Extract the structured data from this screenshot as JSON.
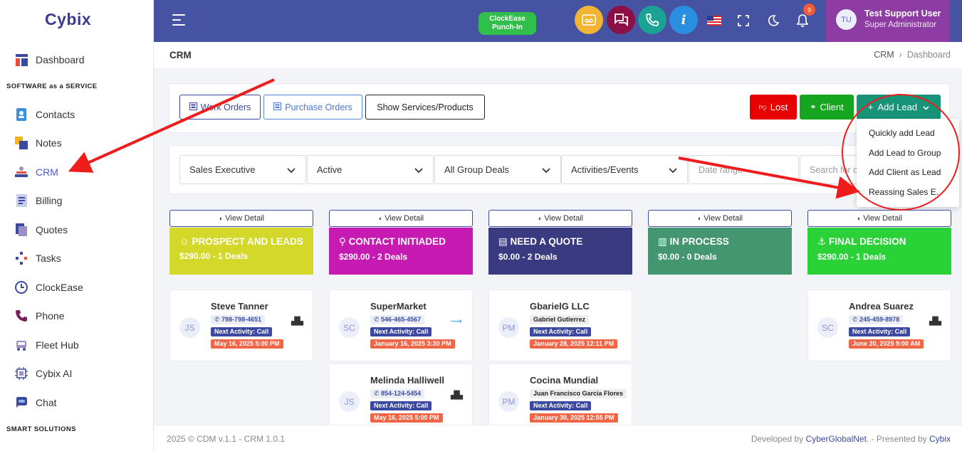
{
  "sidebar": {
    "logo": "Cybix",
    "sections": [
      "SOFTWARE as a SERVICE",
      "SMART SOLUTIONS"
    ],
    "items": [
      {
        "label": "Dashboard",
        "icon": "dashboard-icon"
      },
      {
        "label": "Contacts",
        "icon": "contacts-icon"
      },
      {
        "label": "Notes",
        "icon": "notes-icon"
      },
      {
        "label": "CRM",
        "icon": "crm-icon",
        "active": true
      },
      {
        "label": "Billing",
        "icon": "billing-icon"
      },
      {
        "label": "Quotes",
        "icon": "quotes-icon"
      },
      {
        "label": "Tasks",
        "icon": "tasks-icon"
      },
      {
        "label": "ClockEase",
        "icon": "clock-icon"
      },
      {
        "label": "Phone",
        "icon": "phone-icon"
      },
      {
        "label": "Fleet Hub",
        "icon": "truck-icon"
      },
      {
        "label": "Cybix AI",
        "icon": "ai-chip-icon"
      },
      {
        "label": "Chat",
        "icon": "chat-icon"
      }
    ]
  },
  "header": {
    "punch_label": "ClockEase Punch-In",
    "info_icon": "i",
    "notification_count": "9",
    "user": {
      "initials": "TU",
      "name": "Test Support User",
      "role": "Super Administrator"
    }
  },
  "page": {
    "title": "CRM",
    "breadcrumb": [
      "CRM",
      "Dashboard"
    ]
  },
  "toolbar": {
    "work_orders": "Work Orders",
    "purchase_orders": "Purchase Orders",
    "show_services": "Show Services/Products",
    "lost": "Lost",
    "client": "Client",
    "add_lead": "Add Lead"
  },
  "add_lead_menu": [
    "Quickly add Lead",
    "Add Lead to Group",
    "Add Client as Lead",
    "Reassing Sales E."
  ],
  "filters": {
    "sales_executive": "Sales Executive",
    "status": "Active",
    "group": "All Group Deals",
    "activities": "Activities/Events",
    "date_placeholder": "Date range",
    "search_placeholder": "Search for c"
  },
  "view_detail": "View Detail",
  "stages": [
    {
      "title": "PROSPECT AND LEADS",
      "summary": "$290.00 - 1 Deals",
      "color": "#d4d82a"
    },
    {
      "title": "CONTACT INITIADED",
      "summary": "$290.00 - 2 Deals",
      "color": "#c71ab2"
    },
    {
      "title": "NEED A QUOTE",
      "summary": "$0.00 - 2 Deals",
      "color": "#3a3a80"
    },
    {
      "title": "IN PROCESS",
      "summary": "$0.00 - 0 Deals",
      "color": "#449670"
    },
    {
      "title": "FINAL DECISION",
      "summary": "$290.00 - 1 Deals",
      "color": "#2ad238"
    }
  ],
  "deals": [
    {
      "initials": "JS",
      "name": "Steve Tanner",
      "phone": "798-798-4651",
      "next": "Next Activity: Call",
      "date": "May 16, 2025 5:00 PM"
    },
    {
      "initials": "SC",
      "name": "SuperMarket",
      "phone": "546-465-4567",
      "next": "Next Activity: Call",
      "date": "January 16, 2025 3:30 PM"
    },
    {
      "initials": "JS",
      "name": "Melinda Halliwell",
      "phone": "854-124-5454",
      "next": "Next Activity: Call",
      "date": "May 16, 2025 5:00 PM"
    },
    {
      "initials": "PM",
      "name": "GbarielG LLC",
      "contact": "Gabriel Gutierrez",
      "next": "Next Activity: Call",
      "date": "January 28, 2025 12:11 PM"
    },
    {
      "initials": "PM",
      "name": "Cocina Mundial",
      "contact": "Juan Francisco Garcia Flores",
      "next": "Next Activity: Call",
      "date": "January 30, 2025 12:55 PM"
    },
    {
      "initials": "SC",
      "name": "Andrea Suarez",
      "phone": "245-459-8978",
      "next": "Next Activity: Call",
      "date": "June 20, 2025 9:00 AM"
    }
  ],
  "footer": {
    "left": "2025 © CDM v.1.1 - CRM 1.0.1",
    "right_prefix": "Developed by",
    "right_company": "CyberGlobalNet",
    "right_mid": ". - Presented by",
    "right_brand": "Cybix"
  }
}
